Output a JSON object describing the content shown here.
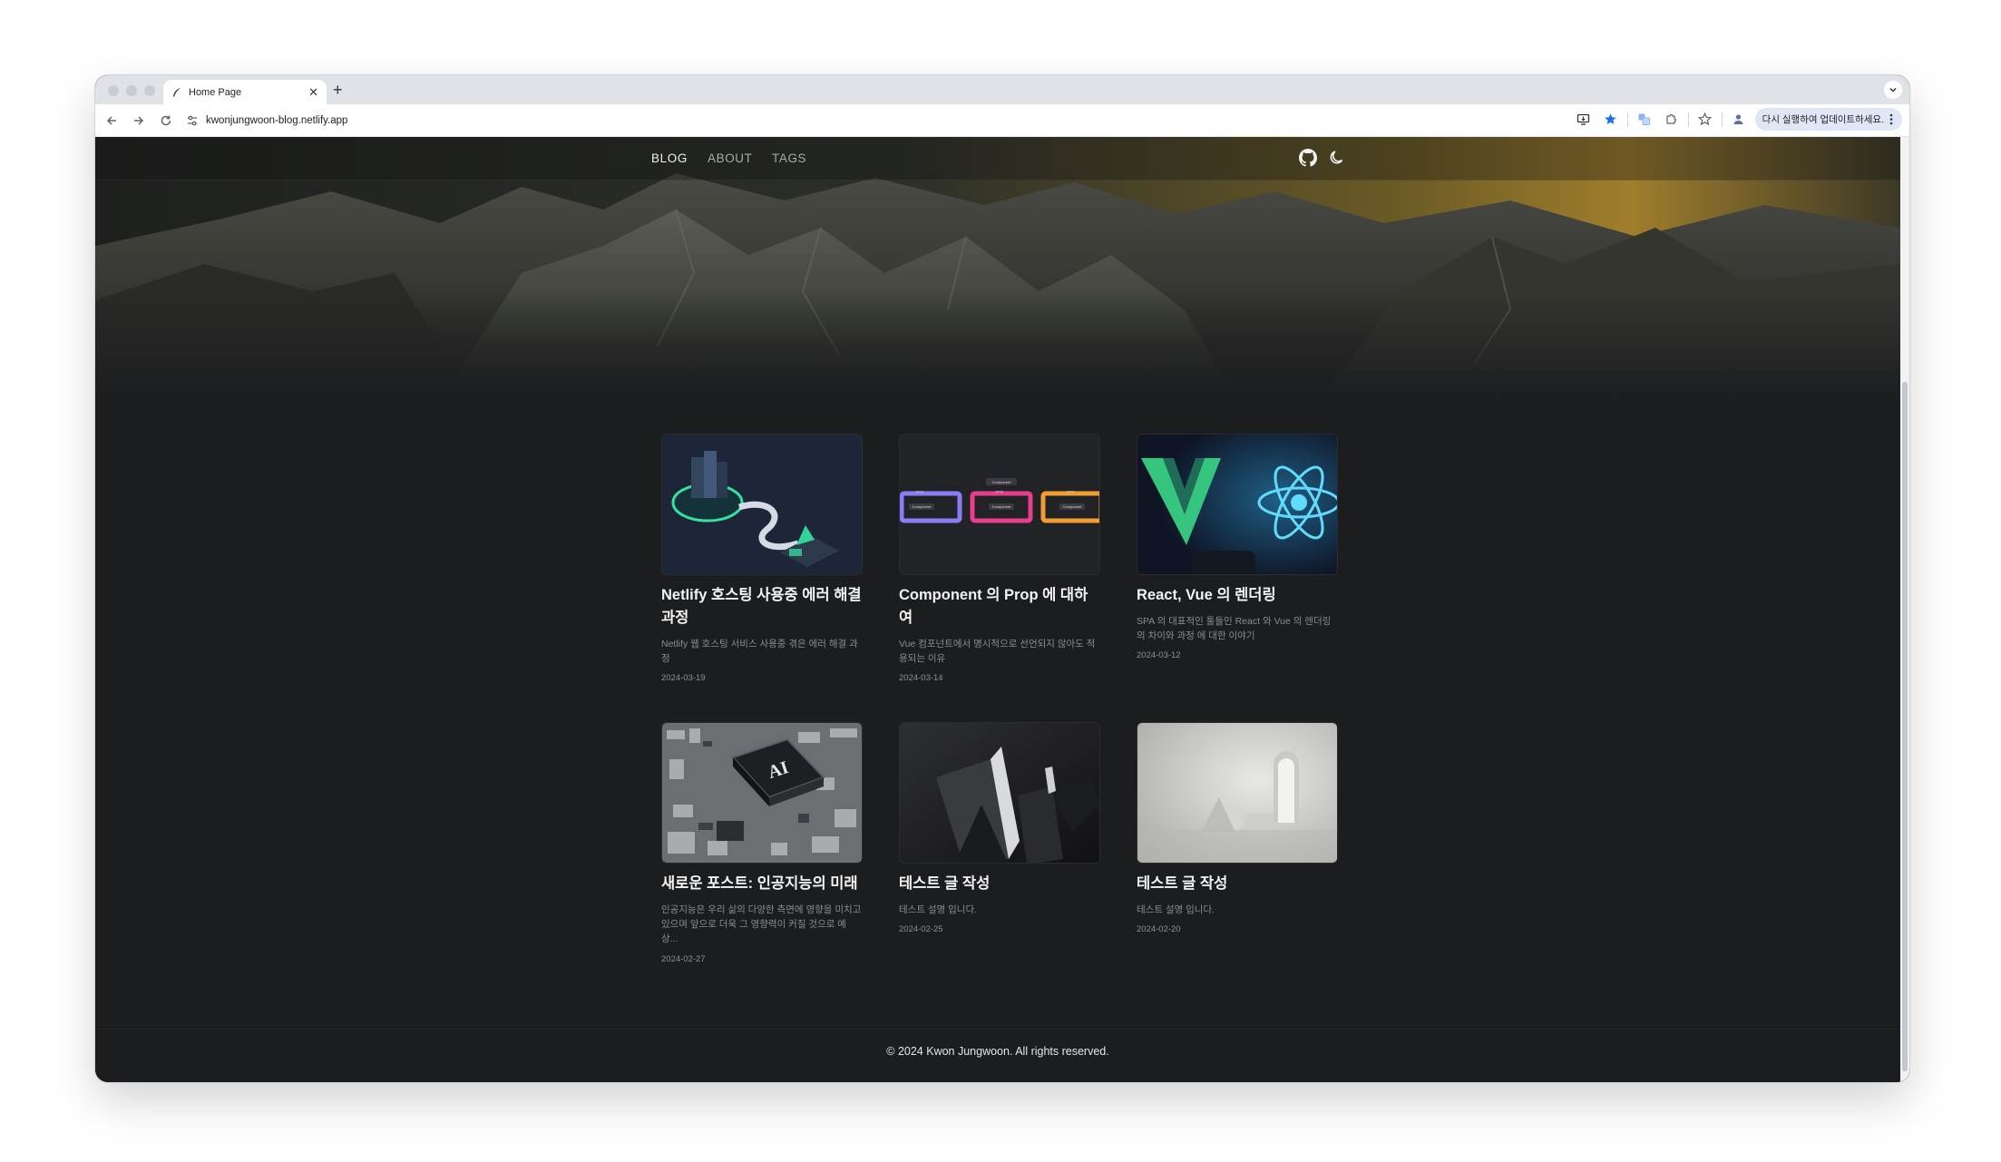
{
  "browser": {
    "tab_title": "Home Page",
    "url": "kwonjungwoon-blog.netlify.app",
    "update_label": "다시 실행하여 업데이트하세요.",
    "accent_color": "#1a73e8"
  },
  "nav": {
    "links": [
      "BLOG",
      "ABOUT",
      "TAGS"
    ],
    "active": "BLOG",
    "icons": [
      "github-icon",
      "moon-icon"
    ]
  },
  "posts": [
    {
      "title": "Netlify 호스팅 사용중 에러 해결 과정",
      "description": "Netlify 웹 호스팅 서비스 사용중 겪은 에러 해결 과정",
      "date": "2024-03-19"
    },
    {
      "title": "Component 의 Prop 에 대하여",
      "description": "Vue 컴포넌트에서 명시적으로 선언되지 않아도 적용되는 이유",
      "date": "2024-03-14"
    },
    {
      "title": "React, Vue 의 렌더링",
      "description": "SPA 의 대표적인 툴들인 React 와 Vue 의 렌더링의 차이와 과정 에 대한 이야기",
      "date": "2024-03-12"
    },
    {
      "title": "새로운 포스트: 인공지능의 미래",
      "description": "인공지능은 우리 삶의 다양한 측면에 영향을 미치고 있으며 앞으로 더욱 그 영향력이 커질 것으로 예상...",
      "date": "2024-02-27",
      "image_text": "AI"
    },
    {
      "title": "테스트 글 작성",
      "description": "테스트 설명 입니다.",
      "date": "2024-02-25"
    },
    {
      "title": "테스트 글 작성",
      "description": "테스트 설명 입니다.",
      "date": "2024-02-20"
    }
  ],
  "diagram_labels": {
    "component": "Component",
    "prop": "prop"
  },
  "footer": {
    "text": "© 2024 Kwon Jungwoon. All rights reserved."
  }
}
